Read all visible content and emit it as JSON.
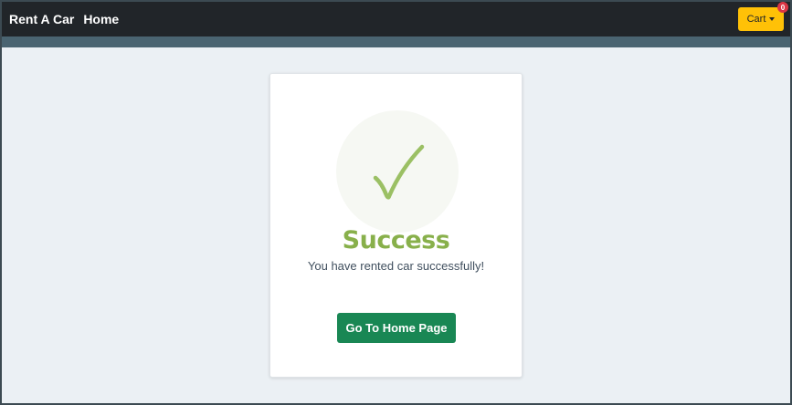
{
  "navbar": {
    "brand": "Rent A Car",
    "home_link": "Home",
    "cart_label": "Cart",
    "cart_count": "0"
  },
  "card": {
    "icon": "checkmark-icon",
    "title": "Success",
    "message": "You have rented car successfully!",
    "button_label": "Go To Home Page"
  },
  "colors": {
    "navbar_bg": "#212529",
    "cart_button": "#ffc107",
    "badge": "#dc3545",
    "success_green": "#88b04b",
    "home_button": "#198754",
    "page_bg": "#ebf0f4"
  }
}
